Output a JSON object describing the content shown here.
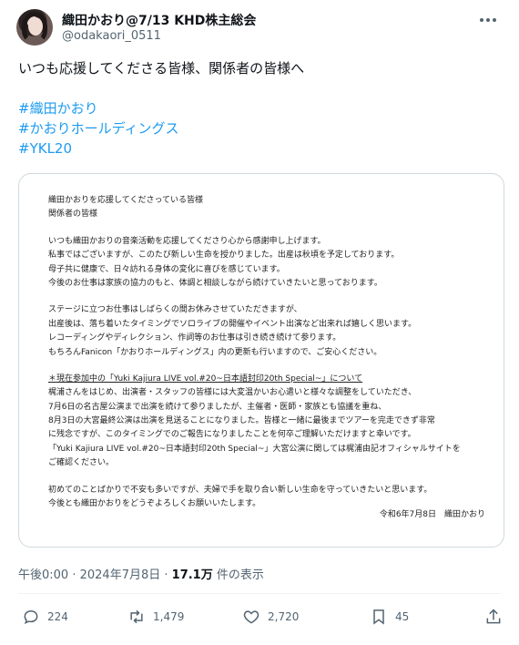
{
  "author": {
    "display_name": "織田かおり@7/13 KHD株主総会",
    "handle": "@odakaori_0511"
  },
  "tweet": {
    "lines": [
      {
        "text": "いつも応援してくださる皆様、関係者の皆様へ",
        "type": "text"
      },
      {
        "text": "",
        "type": "gap"
      },
      {
        "text": "#織田かおり",
        "type": "hashtag"
      },
      {
        "text": "#かおりホールディングス",
        "type": "hashtag"
      },
      {
        "text": "#YKL20",
        "type": "hashtag"
      }
    ]
  },
  "attachment": {
    "lines": [
      "織田かおりを応援してくださっている皆様",
      "関係者の皆様",
      "",
      "いつも織田かおりの音楽活動を応援してくださり心から感謝申し上げます。",
      "私事ではございますが、このたび新しい生命を授かりました。出産は秋頃を予定しております。",
      "母子共に健康で、日々訪れる身体の変化に喜びを感じています。",
      "今後のお仕事は家族の協力のもと、体調と相談しながら続けていきたいと思っております。",
      "",
      "ステージに立つお仕事はしばらくの間お休みさせていただきますが、",
      "出産後は、落ち着いたタイミングでソロライブの開催やイベント出演など出来れば嬉しく思います。",
      "レコーディングやディレクション、作詞等のお仕事は引き続き続けて参ります。",
      "もちろんFanicon「かおりホールディングス」内の更新も行いますので、ご安心ください。",
      "",
      "＊現在参加中の「Yuki Kajiura LIVE vol.#20~日本語封印20th Special~」について",
      "梶浦さんをはじめ、出演者・スタッフの皆様には大変温かいお心遣いと様々な調整をしていただき、",
      "7月6日の名古屋公演まで出演を続けて参りましたが、主催者・医師・家族とも協議を重ね、",
      "8月3日の大宮最終公演は出演を見送ることになりました。皆様と一緒に最後までツアーを完走できず非常",
      "に残念ですが、このタイミングでのご報告になりましたことを何卒ご理解いただけますと幸いです。",
      "「Yuki Kajiura LIVE vol.#20~日本語封印20th Special~」大宮公演に関しては梶浦由記オフィシャルサイトを",
      "ご確認ください。",
      "",
      "初めてのことばかりで不安も多いですが、夫婦で手を取り合い新しい生命を守っていきたいと思います。",
      "今後とも織田かおりをどうぞよろしくお願いいたします。"
    ],
    "signature": "令和6年7月8日　織田かおり"
  },
  "meta": {
    "time": "午後0:00",
    "separator": " · ",
    "date": "2024年7月8日",
    "views_count": "17.1万",
    "views_label": " 件の表示"
  },
  "actions": {
    "replies": "224",
    "reposts": "1,479",
    "likes": "2,720",
    "bookmarks": "45"
  },
  "colors": {
    "accent": "#1d9bf0",
    "muted": "#536471",
    "text": "#0f1419",
    "border": "#cfd9de"
  },
  "icons": [
    "more-icon",
    "reply-icon",
    "repost-icon",
    "like-icon",
    "bookmark-icon",
    "share-icon"
  ]
}
